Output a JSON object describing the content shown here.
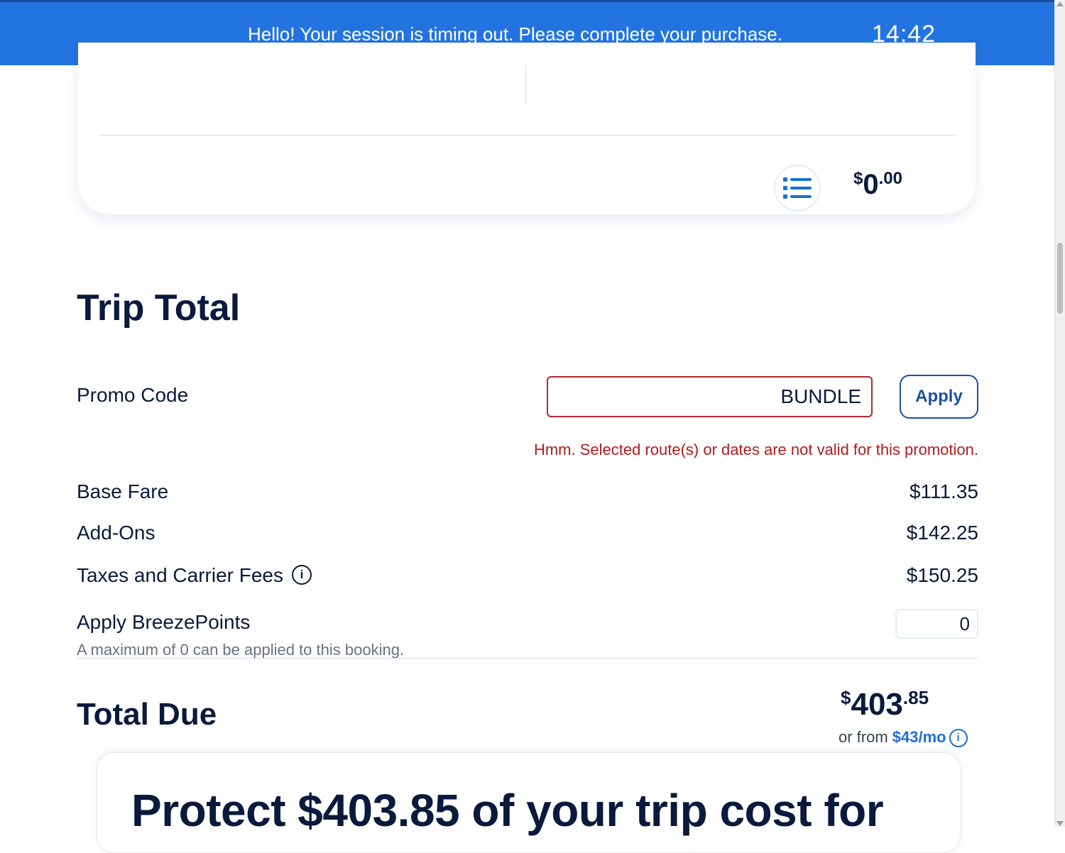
{
  "banner": {
    "message": "Hello! Your session is timing out. Please complete your purchase.",
    "timer": "14:42",
    "color": "#2374e1"
  },
  "top_card": {
    "icon": "list-icon",
    "price_symbol": "$",
    "price_int": "0",
    "price_dec": ".00"
  },
  "trip_total": {
    "title": "Trip Total",
    "promo": {
      "label": "Promo Code",
      "value": "BUNDLE",
      "button": "Apply",
      "error": "Hmm. Selected route(s) or dates are not valid for this promotion."
    },
    "rows": [
      {
        "label": "Base Fare",
        "value": "$111.35"
      },
      {
        "label": "Add-Ons",
        "value": "$142.25"
      },
      {
        "label": "Taxes and Carrier Fees",
        "value": "$150.25",
        "info": "i"
      }
    ],
    "points": {
      "label": "Apply BreezePoints",
      "value": "0",
      "note": "A maximum of 0 can be applied to this booking."
    }
  },
  "total_due": {
    "title": "Total Due",
    "price_symbol": "$",
    "price_int": "403",
    "price_dec": ".85",
    "monthly_prefix": "or from ",
    "monthly_link": "$43/mo",
    "info": "i"
  },
  "protect": {
    "text": "Protect $403.85 of your trip cost for"
  },
  "colors": {
    "navy": "#0a1a3c",
    "error": "#b31b1b",
    "link": "#1f6fd6"
  }
}
